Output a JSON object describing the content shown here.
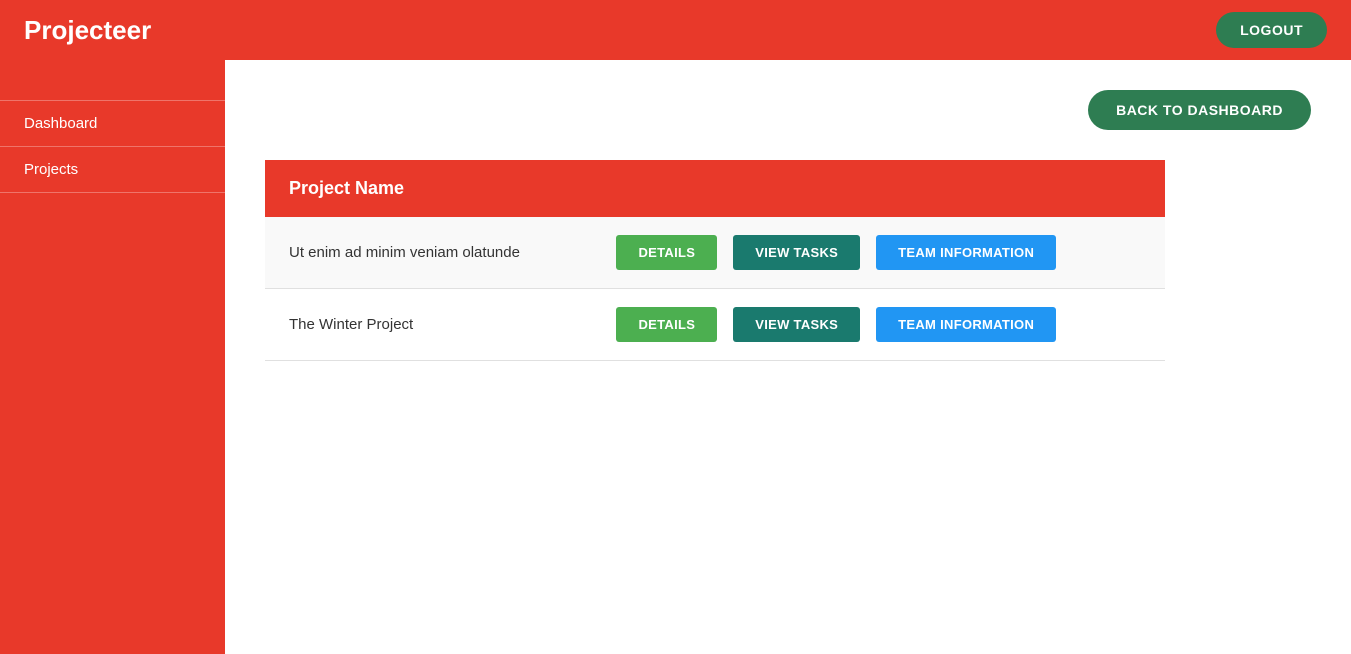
{
  "app": {
    "title": "Projecteer",
    "logout_label": "LOGOUT"
  },
  "sidebar": {
    "items": [
      {
        "label": "Dashboard",
        "name": "dashboard"
      },
      {
        "label": "Projects",
        "name": "projects"
      }
    ]
  },
  "content": {
    "back_button_label": "BACK TO DASHBOARD",
    "table": {
      "header": "Project Name",
      "rows": [
        {
          "name": "Ut enim ad minim veniam olatunde",
          "details_label": "DETAILS",
          "view_tasks_label": "VIEW TASKS",
          "team_info_label": "TEAM INFORMATION"
        },
        {
          "name": "The Winter Project",
          "details_label": "DETAILS",
          "view_tasks_label": "VIEW TASKS",
          "team_info_label": "TEAM INFORMATION"
        }
      ]
    }
  }
}
